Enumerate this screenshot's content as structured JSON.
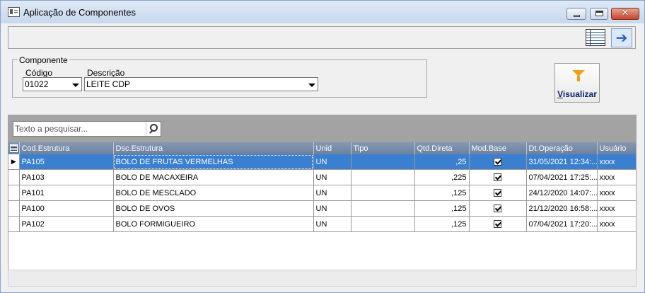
{
  "window": {
    "title": "Aplicação de Componentes",
    "close_glyph": "✕"
  },
  "toolbar": {
    "grid_icon": "grid-list-icon",
    "arrow_icon": "arrow-right-icon",
    "arrow_glyph": "➔"
  },
  "componente": {
    "legend": "Componente",
    "codigo_label": "Código",
    "codigo_value": "01022",
    "descricao_label": "Descrição",
    "descricao_value": "LEITE CDP"
  },
  "visualizar": {
    "accel": "V",
    "rest": "isualizar",
    "icon": "filter-funnel-icon"
  },
  "search": {
    "placeholder": "Texto a pesquisar..."
  },
  "grid": {
    "columns": [
      "Cod.Estrutura",
      "Dsc.Estrutura",
      "Unid",
      "Tipo",
      "Qtd.Direta",
      "Mod.Base",
      "Dt.Operação",
      "Usuário"
    ],
    "selected_marker": "▶",
    "rows": [
      {
        "cod": "PA105",
        "dsc": "BOLO DE FRUTAS VERMELHAS",
        "unid": "UN",
        "tipo": "",
        "qtd": ",25",
        "mod_base": true,
        "dt": "31/05/2021 12:34:...",
        "usuario": "xxxx"
      },
      {
        "cod": "PA103",
        "dsc": "BOLO DE MACAXEIRA",
        "unid": "UN",
        "tipo": "",
        "qtd": ",225",
        "mod_base": true,
        "dt": "07/04/2021 17:25:...",
        "usuario": "xxxx"
      },
      {
        "cod": "PA101",
        "dsc": "BOLO DE MESCLADO",
        "unid": "UN",
        "tipo": "",
        "qtd": ",125",
        "mod_base": true,
        "dt": "24/12/2020 14:07:...",
        "usuario": "xxxx"
      },
      {
        "cod": "PA100",
        "dsc": "BOLO DE OVOS",
        "unid": "UN",
        "tipo": "",
        "qtd": ",125",
        "mod_base": true,
        "dt": "21/12/2020 16:58:...",
        "usuario": "xxxx"
      },
      {
        "cod": "PA102",
        "dsc": "BOLO FORMIGUEIRO",
        "unid": "UN",
        "tipo": "",
        "qtd": ",125",
        "mod_base": true,
        "dt": "07/04/2021 17:20:...",
        "usuario": "xxxx"
      }
    ]
  }
}
